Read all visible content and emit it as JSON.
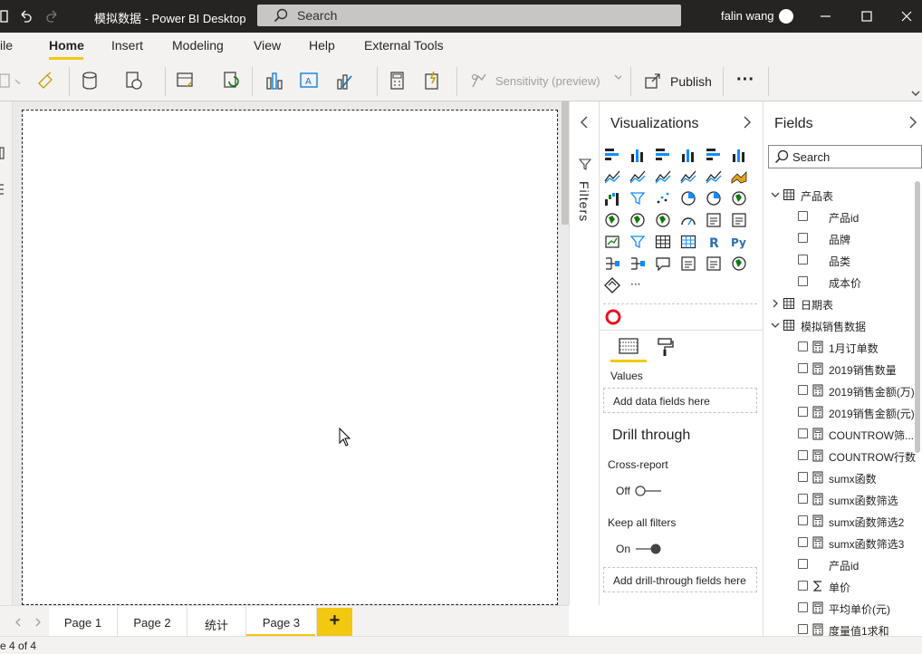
{
  "titlebar": {
    "title": "模拟数据 - Power BI Desktop",
    "search_label": "Search",
    "user": "falin wang"
  },
  "menu": {
    "tabs": [
      "ile",
      "Home",
      "Insert",
      "Modeling",
      "View",
      "Help",
      "External Tools"
    ],
    "active": "Home"
  },
  "ribbon": {
    "sensitivity_label": "Sensitivity (preview)",
    "publish_label": "Publish",
    "more_label": "···"
  },
  "filters": {
    "label": "Filters"
  },
  "visualizations": {
    "title": "Visualizations",
    "more": "···",
    "values_label": "Values",
    "values_placeholder": "Add data fields here",
    "drill_through_title": "Drill through",
    "cross_report_label": "Cross-report",
    "cross_report_state": "Off",
    "keep_filters_label": "Keep all filters",
    "keep_filters_state": "On",
    "drill_placeholder": "Add drill-through fields here",
    "r_label": "R",
    "py_label": "Py"
  },
  "fields": {
    "title": "Fields",
    "search_placeholder": "Search",
    "tables": [
      {
        "name": "产品表",
        "expanded": true,
        "items": [
          "产品id",
          "品牌",
          "品类",
          "成本价"
        ]
      },
      {
        "name": "日期表",
        "expanded": false,
        "items": []
      },
      {
        "name": "模拟销售数据",
        "expanded": true,
        "items": [
          "1月订单数",
          "2019销售数量",
          "2019销售金额(万)",
          "2019销售金额(元)",
          "COUNTROW筛...",
          "COUNTROW行数",
          "sumx函数",
          "sumx函数筛选",
          "sumx函数筛选2",
          "sumx函数筛选3",
          "产品id",
          "单价",
          "平均单价(元)",
          "度量值1求和"
        ]
      }
    ]
  },
  "pages": {
    "tabs": [
      "Page 1",
      "Page 2",
      "统计",
      "Page 3"
    ],
    "active": "Page 3",
    "add_label": "+"
  },
  "status": {
    "page_info": "e 4 of 4"
  }
}
